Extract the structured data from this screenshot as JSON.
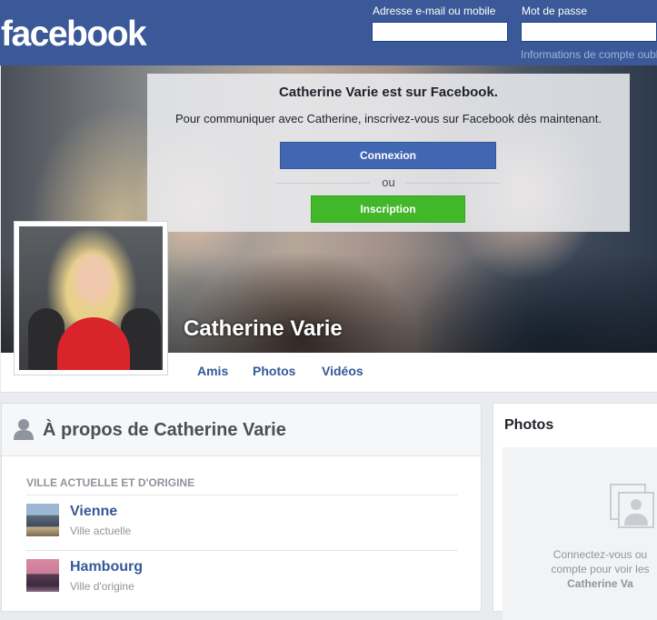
{
  "header": {
    "logo": "facebook",
    "email_label": "Adresse e-mail ou mobile",
    "password_label": "Mot de passe",
    "forgot_link": "Informations de compte oubliées ?"
  },
  "signup": {
    "title": "Catherine Varie est sur Facebook.",
    "text": "Pour communiquer avec Catherine, inscrivez-vous sur Facebook dès maintenant.",
    "login_button": "Connexion",
    "or": "ou",
    "signup_button": "Inscription"
  },
  "profile": {
    "name": "Catherine Varie"
  },
  "nav": {
    "tabs": [
      "Amis",
      "Photos",
      "Vidéos"
    ]
  },
  "about": {
    "title": "À propos de Catherine Varie",
    "section_label": "VILLE ACTUELLE ET D'ORIGINE",
    "places": [
      {
        "name": "Vienne",
        "sub": "Ville actuelle"
      },
      {
        "name": "Hambourg",
        "sub": "Ville d'origine"
      }
    ]
  },
  "photos": {
    "title": "Photos",
    "text_line1": "Connectez-vous ou",
    "text_line2": "compte pour voir les",
    "text_name": "Catherine Va"
  },
  "colors": {
    "brand": "#3b5998",
    "button_blue": "#4267b2",
    "button_green": "#42b72a",
    "link": "#365899"
  }
}
